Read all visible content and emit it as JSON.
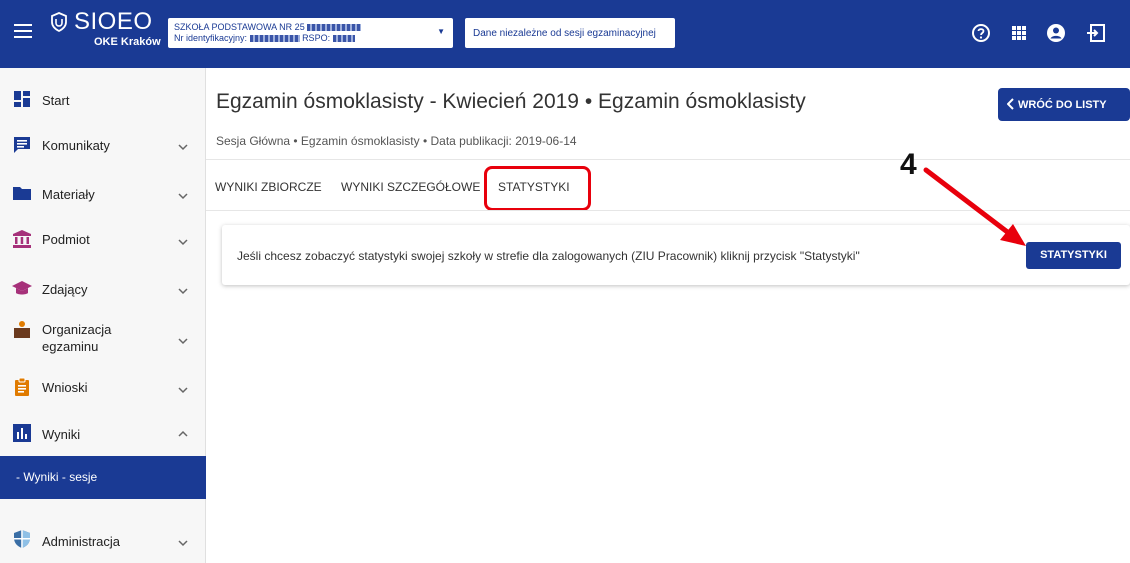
{
  "header": {
    "logo_title": "SIOEO",
    "logo_subtitle": "OKE Kraków",
    "school_line1": "SZKOŁA PODSTAWOWA NR 25",
    "school_line2_label": "Nr identyfikacyjny:",
    "school_line2_rspo": "RSPO:",
    "session_button": "Dane niezależne od sesji egzaminacyjnej",
    "icons": [
      "help-icon",
      "apps-grid-icon",
      "account-icon",
      "logout-icon"
    ],
    "colors": {
      "primary": "#1a3a94",
      "highlight": "#e8000c"
    }
  },
  "sidebar": {
    "items": [
      {
        "label": "Start",
        "icon": "dashboard-icon",
        "has_chevron": false
      },
      {
        "label": "Komunikaty",
        "icon": "message-icon",
        "has_chevron": true
      },
      {
        "label": "Materiały",
        "icon": "folder-icon",
        "has_chevron": true
      },
      {
        "label": "Podmiot",
        "icon": "institution-icon",
        "has_chevron": true
      },
      {
        "label": "Zdający",
        "icon": "graduation-cap-icon",
        "has_chevron": true
      },
      {
        "label_line1": "Organizacja",
        "label_line2": "egzaminu",
        "icon": "teacher-icon",
        "has_chevron": true
      },
      {
        "label": "Wnioski",
        "icon": "clipboard-icon",
        "has_chevron": true
      },
      {
        "label": "Wyniki",
        "icon": "bar-chart-icon",
        "expanded": true
      },
      {
        "label": "Administracja",
        "icon": "shield-icon",
        "has_chevron": true
      }
    ],
    "active_subitem": "- Wyniki - sesje"
  },
  "main": {
    "title": "Egzamin ósmoklasisty - Kwiecień 2019 • Egzamin ósmoklasisty",
    "back_button": "WRÓĆ DO LISTY",
    "breadcrumb": "Sesja Główna • Egzamin ósmoklasisty • Data publikacji: 2019-06-14",
    "tabs": [
      "WYNIKI ZBIORCZE",
      "WYNIKI SZCZEGÓŁOWE",
      "STATYSTYKI"
    ],
    "active_tab": "STATYSTYKI",
    "info_message": "Jeśli chcesz zobaczyć statystyki swojej szkoły w strefie dla zalogowanych (ZIU Pracownik) kliknij przycisk \"Statystyki\"",
    "stats_button": "STATYSTYKI"
  },
  "annotation": {
    "step_number": "4"
  }
}
